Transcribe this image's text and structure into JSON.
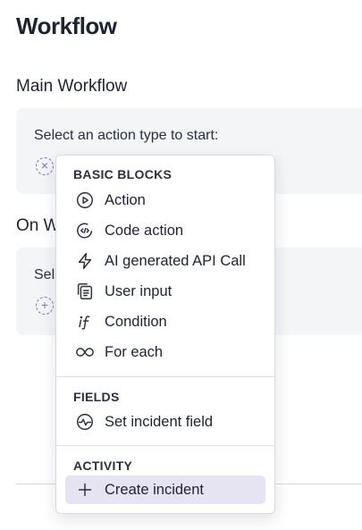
{
  "page": {
    "title": "Workflow"
  },
  "main_workflow": {
    "title": "Main Workflow",
    "prompt": "Select an action type to start:"
  },
  "on_workflow": {
    "title_visible": "On W",
    "prompt_visible": "Sel"
  },
  "dropdown": {
    "groups": [
      {
        "header": "BASIC BLOCKS",
        "items": [
          {
            "label": "Action",
            "icon": "play-circle-icon"
          },
          {
            "label": "Code action",
            "icon": "code-circle-icon"
          },
          {
            "label": "AI generated API Call",
            "icon": "lightning-icon"
          },
          {
            "label": "User input",
            "icon": "form-input-icon"
          },
          {
            "label": "Condition",
            "icon": "if-condition-icon"
          },
          {
            "label": "For each",
            "icon": "loop-icon"
          }
        ]
      },
      {
        "header": "FIELDS",
        "items": [
          {
            "label": "Set incident field",
            "icon": "pulse-circle-icon"
          }
        ]
      },
      {
        "header": "ACTIVITY",
        "items": [
          {
            "label": "Create incident",
            "icon": "plus-icon",
            "highlighted": true
          }
        ]
      }
    ]
  },
  "colors": {
    "accent": "#7c6fd8",
    "card_bg": "#f4f5f7",
    "highlight_bg": "#e6e3f3",
    "title_text": "#1e2235"
  }
}
